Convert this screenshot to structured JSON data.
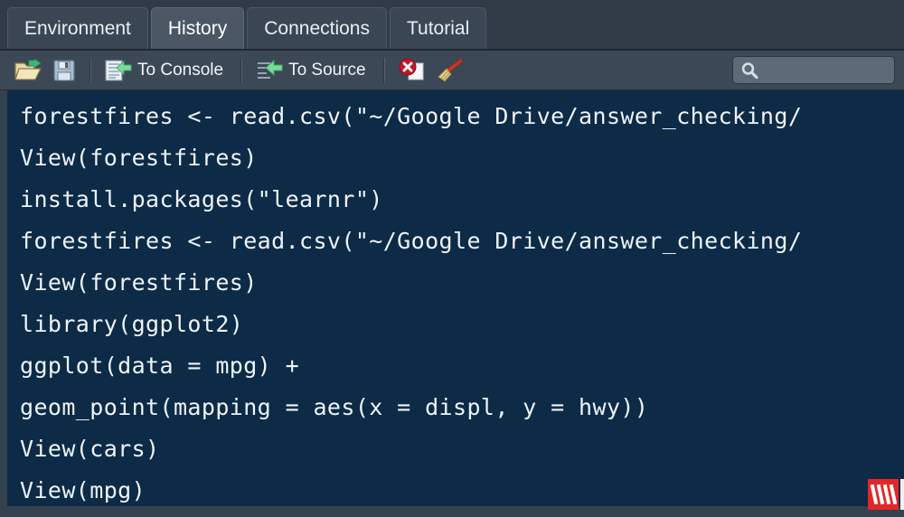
{
  "window": {
    "pane_title": "History",
    "background_color": "#34414e",
    "code_background_color": "#0d2b46",
    "accent_color": "#7bd89a"
  },
  "tabs": [
    {
      "label": "Environment",
      "active": false
    },
    {
      "label": "History",
      "active": true
    },
    {
      "label": "Connections",
      "active": false
    },
    {
      "label": "Tutorial",
      "active": false
    }
  ],
  "toolbar": {
    "load_icon": "open-folder-icon",
    "save_icon": "floppy-disk-icon",
    "to_console_label": "To Console",
    "to_console_icon": "to-console-arrow-icon",
    "to_source_label": "To Source",
    "to_source_icon": "to-source-arrow-icon",
    "remove_icon": "remove-entry-icon",
    "clear_icon": "clear-all-broom-icon"
  },
  "search": {
    "value": "",
    "placeholder": "",
    "icon": "search-icon"
  },
  "history": {
    "lines": [
      "forestfires <- read.csv(\"~/Google Drive/answer_checking/",
      "View(forestfires)",
      "install.packages(\"learnr\")",
      "forestfires <- read.csv(\"~/Google Drive/answer_checking/",
      "View(forestfires)",
      "library(ggplot2)",
      "ggplot(data = mpg) +",
      "geom_point(mapping = aes(x = displ, y = hwy))",
      "View(cars)",
      "View(mpg)"
    ]
  },
  "corner_badge": {
    "name": "red-logo-badge",
    "color": "#e02828"
  }
}
